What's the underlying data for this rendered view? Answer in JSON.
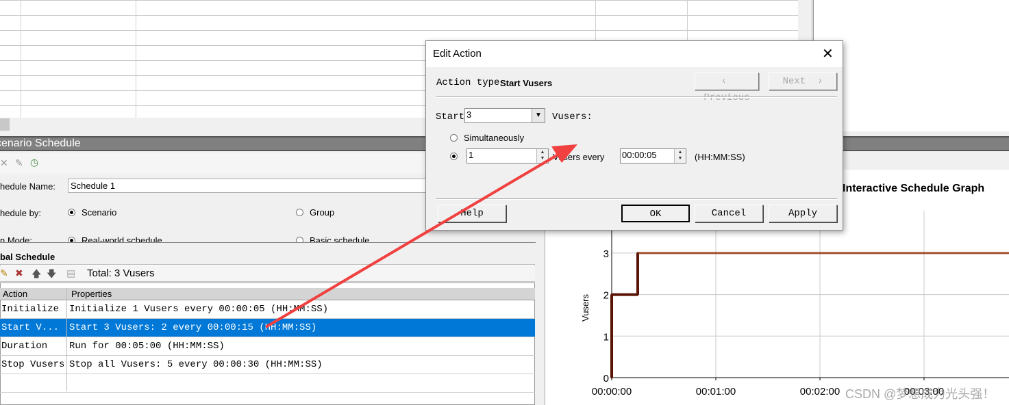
{
  "schedule_panel": {
    "header_title": "cenario Schedule",
    "schedule_name_label": "hedule Name:",
    "schedule_name_value": "Schedule 1",
    "schedule_by_label": "hedule by:",
    "schedule_by_options": [
      "Scenario",
      "Group"
    ],
    "schedule_by_selected": "Scenario",
    "run_mode_label": "n Mode:",
    "run_mode_options": [
      "Real-world schedule",
      "Basic schedule"
    ],
    "run_mode_selected": "Real-world schedule"
  },
  "global_schedule": {
    "title": "bal Schedule",
    "total": "Total: 3 Vusers",
    "columns": [
      "Action",
      "Properties"
    ],
    "rows": [
      {
        "action": "Initialize",
        "properties": "Initialize 1 Vusers every 00:00:05 (HH:MM:SS)"
      },
      {
        "action": "Start  V...",
        "properties": "Start 3 Vusers: 2 every 00:00:15 (HH:MM:SS)",
        "selected": true
      },
      {
        "action": "Duration",
        "properties": "Run for 00:05:00 (HH:MM:SS)"
      },
      {
        "action": "Stop Vusers",
        "properties": "Stop all Vusers: 5 every 00:00:30 (HH:MM:SS)"
      }
    ],
    "selection_color": "#0078d7"
  },
  "dialog": {
    "title": "Edit Action",
    "action_type_label": "Action type",
    "action_type_value": "Start Vusers",
    "previous_label": "Previous",
    "next_label": "Next",
    "start_label": "Start",
    "start_value": "3",
    "vusers_label": "Vusers:",
    "simultaneously_label": "Simultaneously",
    "every_count_value": "1",
    "vusers_every_label": "Vusers every",
    "interval_value": "00:00:05",
    "format_label": "(HH:MM:SS)",
    "selected_mode": "every",
    "help_label": "Help",
    "ok_label": "OK",
    "cancel_label": "Cancel",
    "apply_label": "Apply"
  },
  "chart_data": {
    "type": "line",
    "title": "Interactive Schedule Graph",
    "ylabel": "Vusers",
    "xlabel": "",
    "x_ticks": [
      "00:00:00",
      "00:01:00",
      "00:02:00",
      "00:03:00"
    ],
    "y_ticks": [
      0,
      1,
      2,
      3
    ],
    "grid": true,
    "series": [
      {
        "x": [
          "00:00:00",
          "00:00:00",
          "00:00:15",
          "00:00:15",
          "00:03:50"
        ],
        "y": [
          0,
          2,
          2,
          3,
          3
        ],
        "color": "#a0522d",
        "highlight_color": "#5a1405"
      }
    ]
  },
  "watermark": "CSDN @梦想成为光头强！",
  "annotation_arrow_color": "#f04040"
}
